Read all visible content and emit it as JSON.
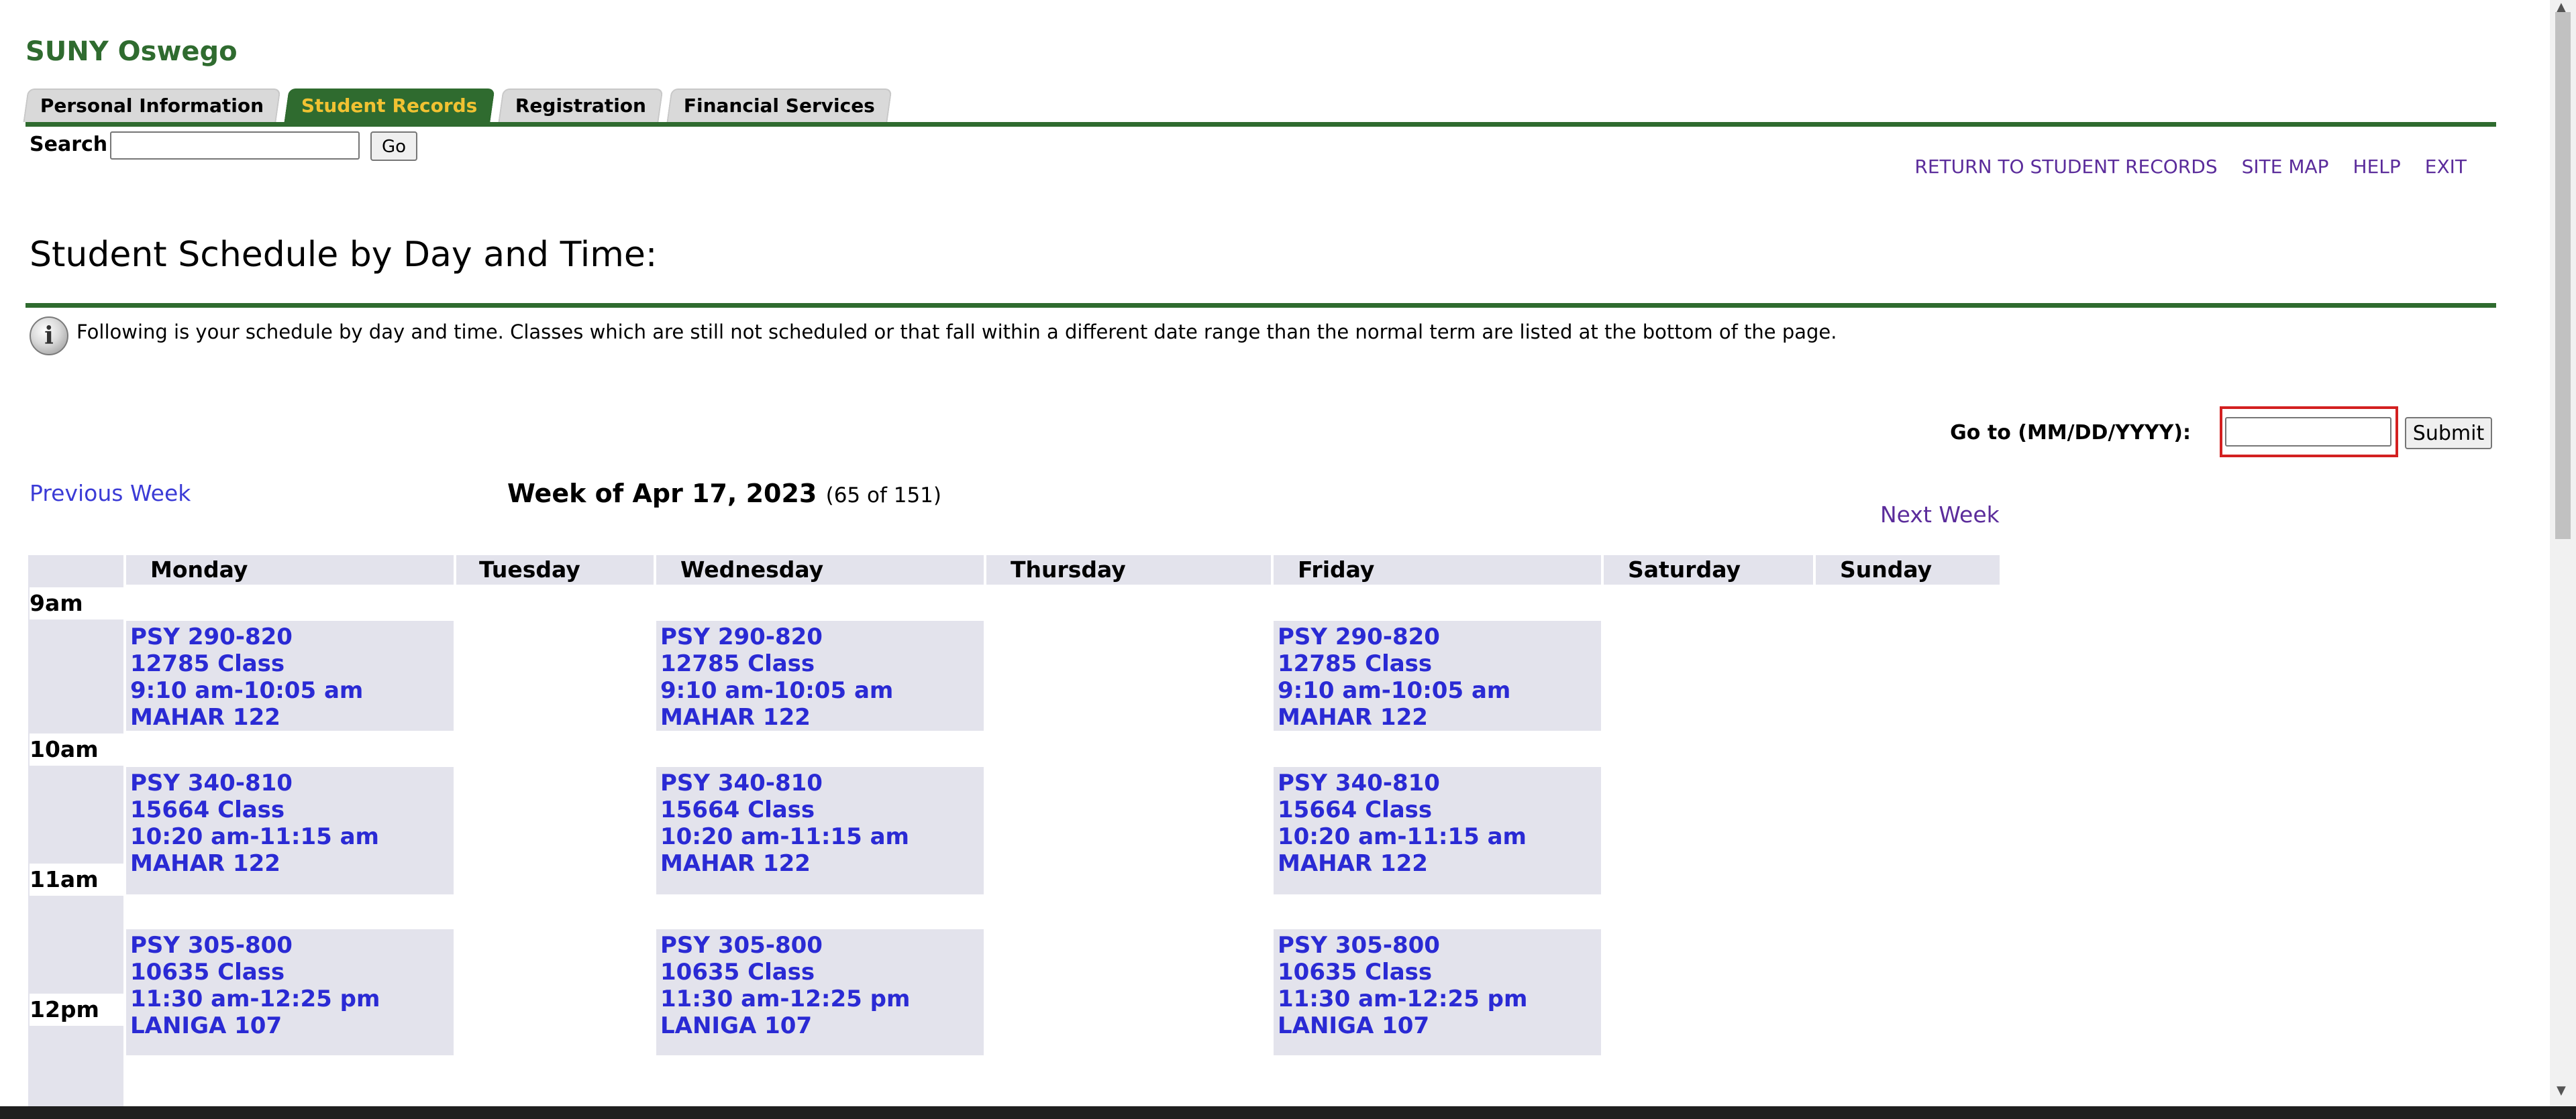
{
  "header": {
    "institution": "SUNY Oswego",
    "tabs": [
      {
        "label": "Personal Information",
        "active": false
      },
      {
        "label": "Student Records",
        "active": true
      },
      {
        "label": "Registration",
        "active": false
      },
      {
        "label": "Financial Services",
        "active": false
      }
    ],
    "search_label": "Search",
    "search_value": "",
    "go_label": "Go",
    "links": [
      "RETURN TO STUDENT RECORDS",
      "SITE MAP",
      "HELP",
      "EXIT"
    ]
  },
  "page_title": "Student Schedule by Day and Time:",
  "info_text": "Following is your schedule by day and time. Classes which are still not scheduled or that fall within a different date range than the normal term are listed at the bottom of the page.",
  "goto": {
    "label": "Go to (MM/DD/YYYY):",
    "value": "",
    "submit_label": "Submit"
  },
  "nav": {
    "previous_week": "Previous Week",
    "next_week": "Next Week",
    "week_of": "Week of Apr 17, 2023",
    "week_count": "(65 of 151)"
  },
  "schedule": {
    "days": [
      "Monday",
      "Tuesday",
      "Wednesday",
      "Thursday",
      "Friday",
      "Saturday",
      "Sunday"
    ],
    "times": [
      "9am",
      "10am",
      "11am",
      "12pm"
    ],
    "classes": [
      {
        "course": "PSY 290-820",
        "crn": "12785 Class",
        "time": "9:10 am-10:05 am",
        "room": "MAHAR 122",
        "days": [
          "Monday",
          "Wednesday",
          "Friday"
        ]
      },
      {
        "course": "PSY 340-810",
        "crn": "15664 Class",
        "time": "10:20 am-11:15 am",
        "room": "MAHAR 122",
        "days": [
          "Monday",
          "Wednesday",
          "Friday"
        ]
      },
      {
        "course": "PSY 305-800",
        "crn": "10635 Class",
        "time": "11:30 am-12:25 pm",
        "room": "LANIGA 107",
        "days": [
          "Monday",
          "Wednesday",
          "Friday"
        ]
      }
    ]
  },
  "colors": {
    "brand_green": "#2f6b2f",
    "tab_active_text": "#f1c232",
    "link_blue": "#2a2ad4",
    "grid_bg": "#e3e3ec",
    "highlight_red": "#d32020"
  }
}
